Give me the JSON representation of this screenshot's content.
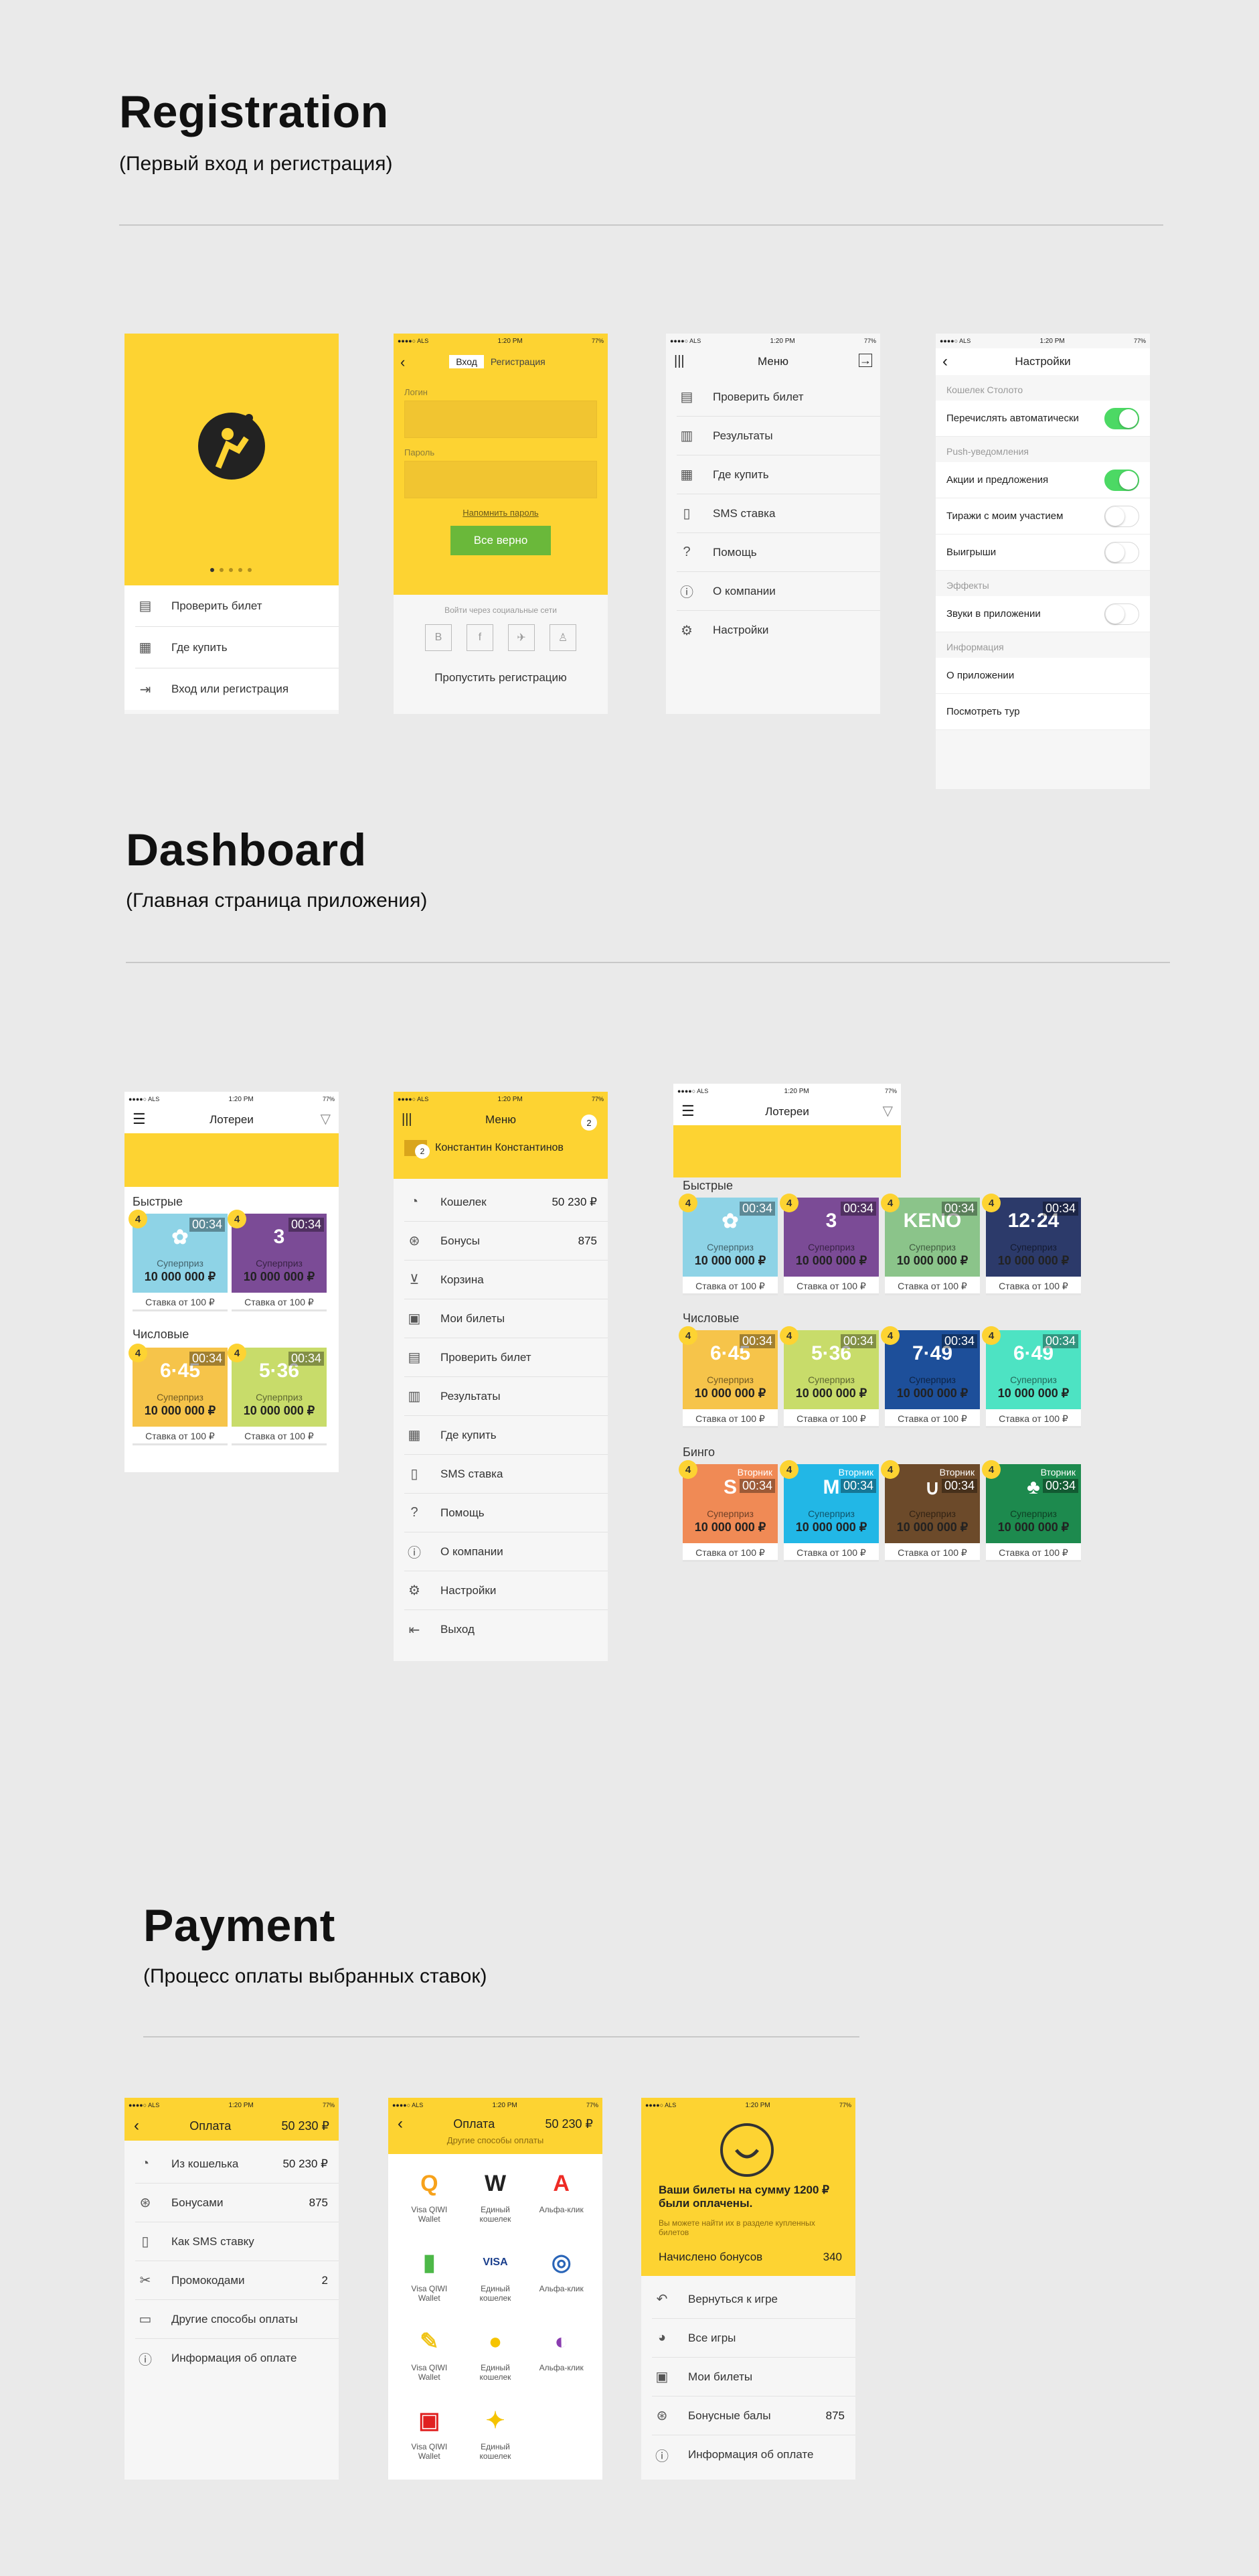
{
  "sections": {
    "registration": {
      "title": "Registration",
      "subtitle": "(Первый вход и регистрация)"
    },
    "dashboard": {
      "title": "Dashboard",
      "subtitle": "(Главная страница приложения)"
    },
    "payment": {
      "title": "Payment",
      "subtitle": "(Процесс оплаты выбранных ставок)"
    }
  },
  "status": {
    "carrier": "●●●●○ ALS",
    "time": "1:20 PM",
    "battery": "77%"
  },
  "onboarding": {
    "items": [
      {
        "label": "Проверить билет",
        "icon": "ticket-check-icon"
      },
      {
        "label": "Где купить",
        "icon": "store-icon"
      },
      {
        "label": "Вход или регистрация",
        "icon": "login-icon"
      }
    ]
  },
  "login": {
    "tab_login": "Вход",
    "tab_register": "Регистрация",
    "login_label": "Логин",
    "password_label": "Пароль",
    "remind": "Напомнить пароль",
    "submit": "Все верно",
    "social_caption": "Войти через социальные сети",
    "social": [
      "B",
      "f",
      "tw",
      "ok"
    ],
    "skip": "Пропустить регистрацию"
  },
  "menu1": {
    "title": "Меню",
    "items": [
      {
        "label": "Проверить билет",
        "icon": "ticket-check-icon"
      },
      {
        "label": "Результаты",
        "icon": "results-icon"
      },
      {
        "label": "Где купить",
        "icon": "store-icon"
      },
      {
        "label": "SMS ставка",
        "icon": "sms-icon"
      },
      {
        "label": "Помощь",
        "icon": "help-icon"
      },
      {
        "label": "О компании",
        "icon": "info-icon"
      },
      {
        "label": "Настройки",
        "icon": "settings-icon"
      }
    ]
  },
  "settings": {
    "title": "Настройки",
    "cap_wallet": "Кошелек Столото",
    "auto_transfer": "Перечислять автоматически",
    "cap_push": "Push-уведомления",
    "promo": "Акции и предложения",
    "draws": "Тиражи с моим участием",
    "wins": "Выигрыши",
    "cap_effects": "Эффекты",
    "sounds": "Звуки в приложении",
    "cap_info": "Информация",
    "about": "О приложении",
    "tour": "Посмотреть тур"
  },
  "lotteries": {
    "title": "Лотереи",
    "fast": "Быстрые",
    "numeric": "Числовые",
    "bingo": "Бинго",
    "badge": "4",
    "time": "00:34",
    "super": "Суперприз",
    "prize": "10 000 000 ₽",
    "bet": "Ставка от 100 ₽",
    "weekday": "Вторник"
  },
  "menu2": {
    "title": "Меню",
    "badge": "2",
    "user": "Константин Константинов",
    "items": [
      {
        "label": "Кошелек",
        "value": "50 230 ₽",
        "icon": "wallet-icon"
      },
      {
        "label": "Бонусы",
        "value": "875",
        "icon": "bonus-icon"
      },
      {
        "label": "Корзина",
        "value": "",
        "icon": "cart-icon"
      },
      {
        "label": "Мои билеты",
        "value": "",
        "icon": "tickets-icon"
      },
      {
        "label": "Проверить билет",
        "value": "",
        "icon": "ticket-check-icon"
      },
      {
        "label": "Результаты",
        "value": "",
        "icon": "results-icon"
      },
      {
        "label": "Где купить",
        "value": "",
        "icon": "store-icon"
      },
      {
        "label": "SMS ставка",
        "value": "",
        "icon": "sms-icon"
      },
      {
        "label": "Помощь",
        "value": "",
        "icon": "help-icon"
      },
      {
        "label": "О компании",
        "value": "",
        "icon": "info-icon"
      },
      {
        "label": "Настройки",
        "value": "",
        "icon": "settings-icon"
      },
      {
        "label": "Выход",
        "value": "",
        "icon": "logout-icon"
      }
    ]
  },
  "pay1": {
    "title": "Оплата",
    "balance": "50 230 ₽",
    "items": [
      {
        "label": "Из кошелька",
        "value": "50 230 ₽",
        "icon": "wallet-icon"
      },
      {
        "label": "Бонусами",
        "value": "875",
        "icon": "bonus-icon"
      },
      {
        "label": "Как SMS ставку",
        "value": "",
        "icon": "sms-icon"
      },
      {
        "label": "Промокодами",
        "value": "2",
        "icon": "promo-icon"
      },
      {
        "label": "Другие способы оплаты",
        "value": "",
        "icon": "card-icon"
      },
      {
        "label": "Информация об оплате",
        "value": "",
        "icon": "info-icon"
      }
    ]
  },
  "pay2": {
    "title": "Оплата",
    "balance": "50 230 ₽",
    "sub": "Другие способы оплаты",
    "methods": [
      {
        "name": "Visa QIWI Wallet",
        "logo": "Q",
        "color": "#f7a21b"
      },
      {
        "name": "Единый кошелек",
        "logo": "W",
        "color": "#222222"
      },
      {
        "name": "Альфа-клик",
        "logo": "А",
        "color": "#ee2b25"
      },
      {
        "name": "Visa QIWI Wallet",
        "logo": "▮",
        "color": "#4db848"
      },
      {
        "name": "Единый кошелек",
        "logo": "VISA",
        "color": "#1a3e8c"
      },
      {
        "name": "Альфа-клик",
        "logo": "◎",
        "color": "#2a65b8"
      },
      {
        "name": "Visa QIWI Wallet",
        "logo": "✎",
        "color": "#f0c419"
      },
      {
        "name": "Единый кошелек",
        "logo": "●",
        "color": "#f6c400"
      },
      {
        "name": "Альфа-клик",
        "logo": "◐",
        "color": "#8a3db0"
      },
      {
        "name": "Visa QIWI Wallet",
        "logo": "▣",
        "color": "#e02020"
      },
      {
        "name": "Единый кошелек",
        "logo": "✦",
        "color": "#f5c300"
      }
    ]
  },
  "pay3": {
    "message": "Ваши билеты на сумму 1200 ₽ были оплачены.",
    "note": "Вы можете найти их в разделе купленных билетов",
    "bonus_label": "Начислено бонусов",
    "bonus_value": "340",
    "items": [
      {
        "label": "Вернуться к игре",
        "value": "",
        "icon": "back-icon"
      },
      {
        "label": "Все игры",
        "value": "",
        "icon": "games-icon"
      },
      {
        "label": "Мои билеты",
        "value": "",
        "icon": "tickets-icon"
      },
      {
        "label": "Бонусные балы",
        "value": "875",
        "icon": "bonus-icon"
      },
      {
        "label": "Информация об оплате",
        "value": "",
        "icon": "info-icon"
      }
    ]
  },
  "colors": {
    "brand_yellow": "#fdd332",
    "toggle_on": "#4cd964",
    "button_green": "#6ab83a"
  }
}
